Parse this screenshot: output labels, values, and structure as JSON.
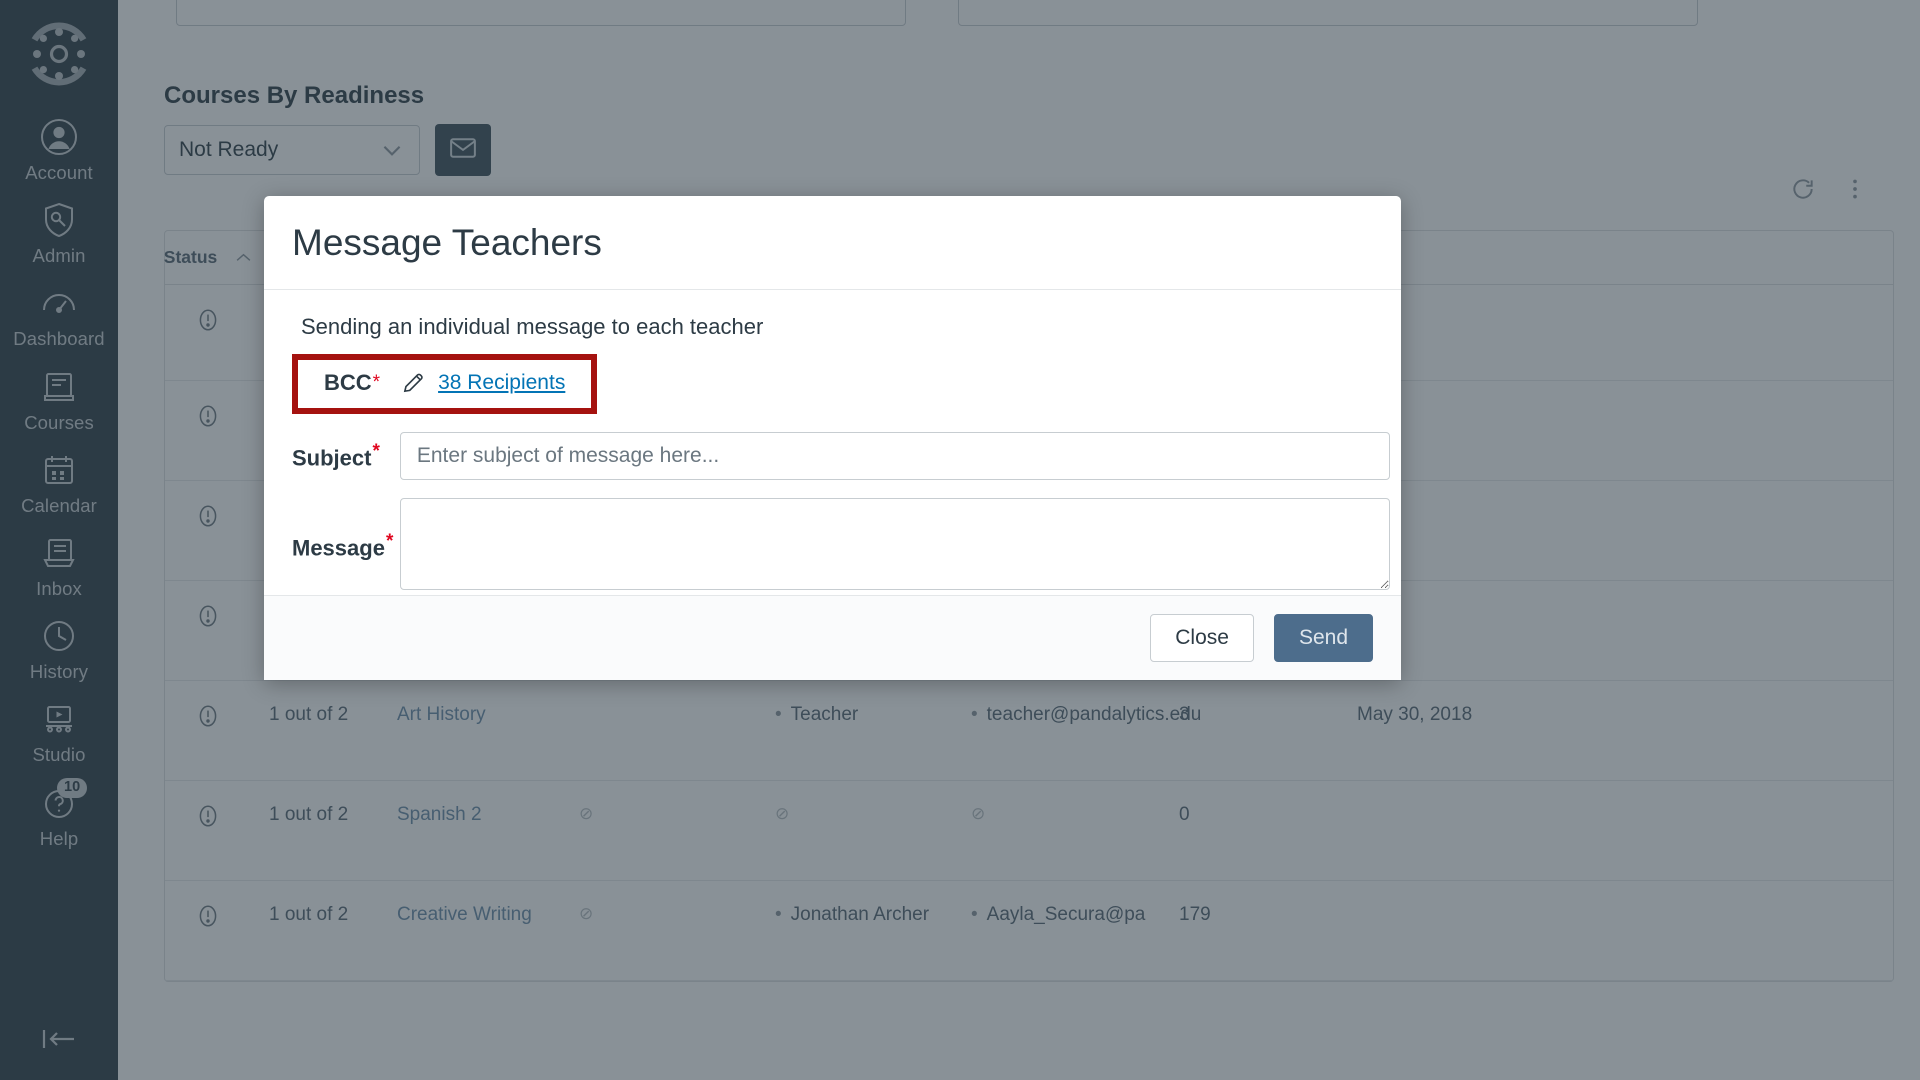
{
  "globalnav": {
    "logo_icon": "canvas-logo-icon",
    "items": [
      {
        "label": "Account",
        "icon": "user-avatar-icon",
        "badge": null
      },
      {
        "label": "Admin",
        "icon": "shield-tool-icon",
        "badge": null
      },
      {
        "label": "Dashboard",
        "icon": "gauge-icon",
        "badge": null
      },
      {
        "label": "Courses",
        "icon": "book-icon",
        "badge": null
      },
      {
        "label": "Calendar",
        "icon": "calendar-icon",
        "badge": null
      },
      {
        "label": "Inbox",
        "icon": "inbox-tray-icon",
        "badge": null
      },
      {
        "label": "History",
        "icon": "clock-icon",
        "badge": null
      },
      {
        "label": "Studio",
        "icon": "studio-play-icon",
        "badge": null
      },
      {
        "label": "Help",
        "icon": "help-question-icon",
        "badge": "10"
      }
    ],
    "collapse_icon": "collapse-arrow-icon"
  },
  "page": {
    "courses_by_readiness_title": "Courses By Readiness",
    "readiness_filter_value": "Not Ready",
    "readiness_filter_caret": "chevron-down-icon",
    "message_button_icon": "envelope-icon",
    "refresh_icon": "refresh-icon",
    "more_icon": "kebab-menu-icon"
  },
  "table": {
    "headers": [
      {
        "label": "Status",
        "sort": "caret-up-icon"
      }
    ],
    "rows": [
      {
        "status_icon": "warning-circle-icon",
        "readiness": "1 out of 2",
        "course": "Art History",
        "blank": "",
        "teacher": "Teacher",
        "email": "teacher@pandalytics.edu",
        "count": "3",
        "date": "May 30, 2018"
      },
      {
        "status_icon": "warning-circle-icon",
        "readiness": "1 out of 2",
        "course": "Spanish 2",
        "blank": "⊘",
        "teacher": "⊘",
        "email": "⊘",
        "count": "0",
        "date": ""
      },
      {
        "status_icon": "warning-circle-icon",
        "readiness": "1 out of 2",
        "course": "Creative Writing",
        "blank": "⊘",
        "teacher": "Jonathan Archer",
        "email": "Aayla_Secura@pa",
        "count": "179",
        "date": ""
      }
    ]
  },
  "modal": {
    "title": "Message Teachers",
    "sending_note": "Sending an individual message to each teacher",
    "bcc": {
      "label": "BCC",
      "required_mark": "*",
      "pencil_icon": "pencil-edit-icon",
      "recipients_link": "38 Recipients",
      "highlight_color": "#a5120f"
    },
    "subject": {
      "label": "Subject",
      "required_mark": "*",
      "value": "",
      "placeholder": "Enter subject of message here..."
    },
    "message": {
      "label": "Message",
      "required_mark": "*",
      "value": "",
      "placeholder": ""
    },
    "footer": {
      "close_label": "Close",
      "send_label": "Send",
      "send_color": "#4d6d8c"
    }
  }
}
